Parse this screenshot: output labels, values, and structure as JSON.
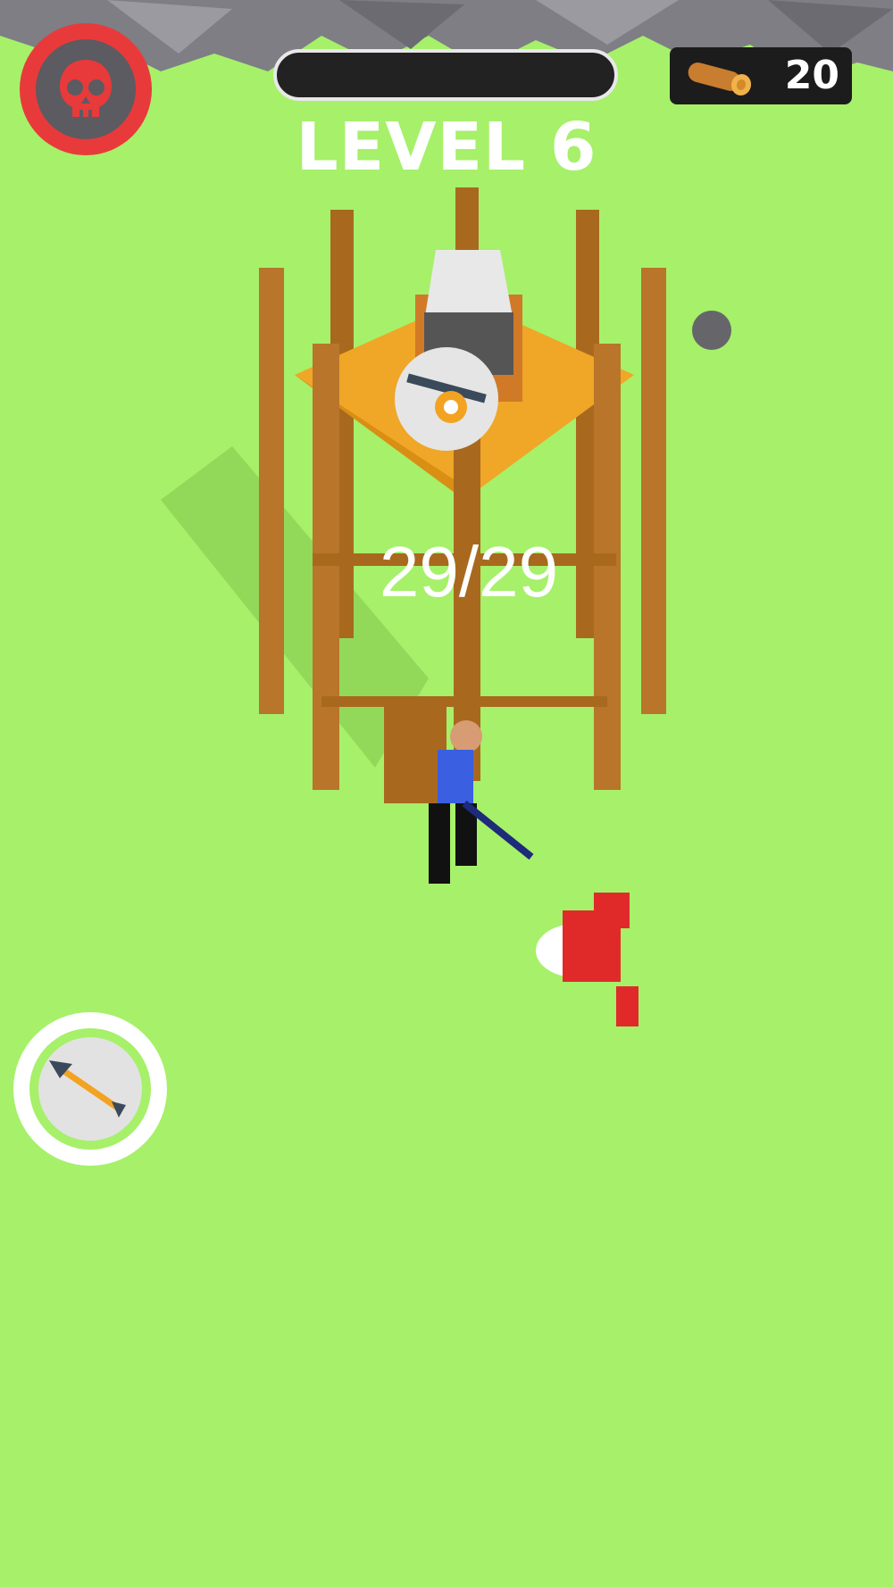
{
  "hud": {
    "level_label": "LEVEL 6",
    "wood_count": "20",
    "progress_fraction": 0
  },
  "tower": {
    "counter_label": "29/29",
    "badge": "cannon-icon"
  },
  "weapon_button": {
    "icon": "arrow-icon"
  },
  "colors": {
    "grass": "#a6f06a",
    "wood": "#b9752a",
    "platform": "#f0a626",
    "skull_button": "#e83a3a",
    "enemy": "#e02a2a",
    "player_shirt": "#3a5fe0"
  }
}
